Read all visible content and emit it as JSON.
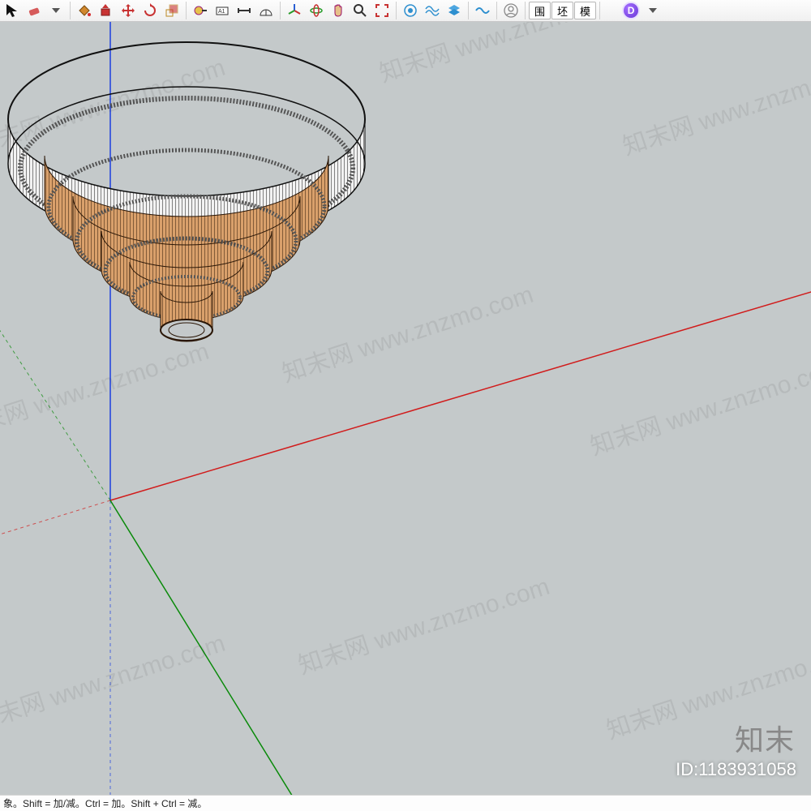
{
  "toolbar": {
    "mode_buttons": [
      "围",
      "坯",
      "模"
    ]
  },
  "statusbar": {
    "text": "象。Shift = 加/减。Ctrl = 加。Shift + Ctrl = 减。"
  },
  "watermark": {
    "site": "知末网 www.znzmo.com",
    "brand": "知末",
    "id_label": "ID:1183931058"
  },
  "icons": {
    "select": "select-tool",
    "eraser": "eraser-tool",
    "bucket": "paint-bucket",
    "move": "move-tool",
    "rotate": "rotate-tool",
    "scale": "scale-tool",
    "offset": "offset-tool",
    "tape": "tape-measure",
    "dim": "dimension-tool",
    "text": "text-tool",
    "protractor": "protractor-tool",
    "axes": "axes-tool",
    "orbit": "orbit-tool",
    "pan": "pan-tool",
    "zoom": "zoom-tool",
    "zoom_ext": "zoom-extents",
    "plugin1": "plugin-gear-1",
    "plugin2": "plugin-wave",
    "plugin3": "plugin-layers",
    "plugin4": "plugin-wave-2",
    "user": "user-icon",
    "round": "round-plugin"
  }
}
